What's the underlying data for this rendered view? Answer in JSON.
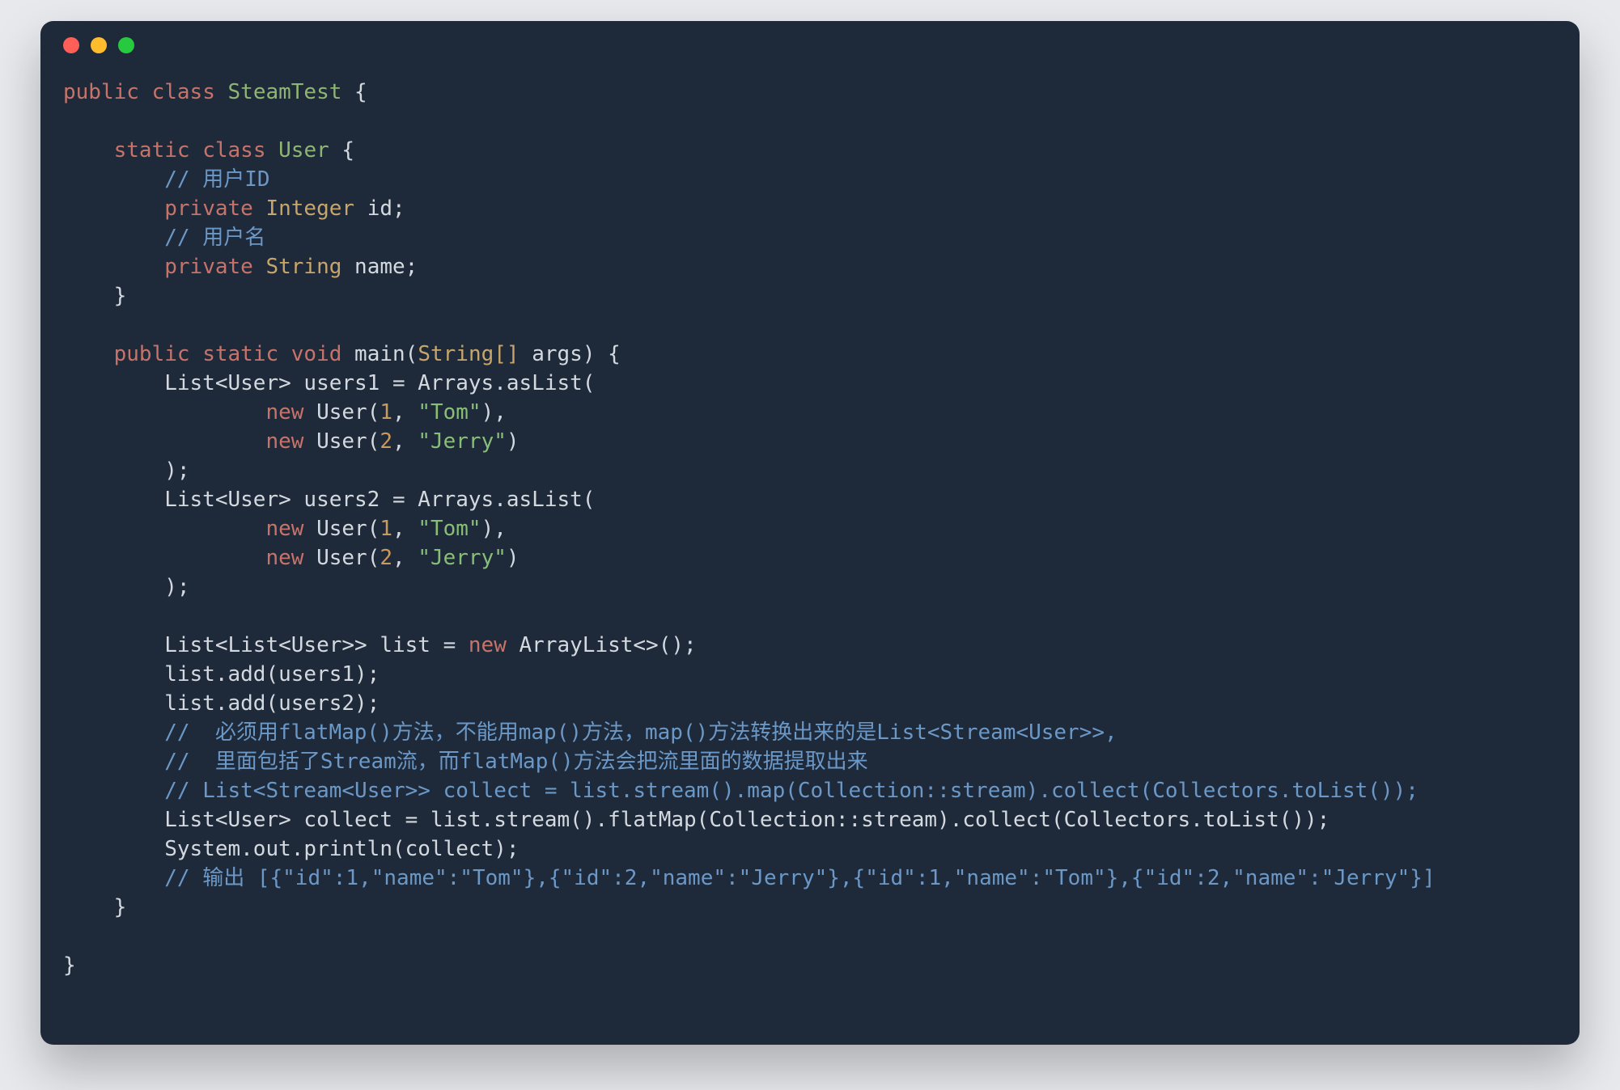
{
  "window": {
    "dots": {
      "red": "#ff5f56",
      "yellow": "#ffbd2e",
      "green": "#27c93f"
    },
    "bg": "#1e2a3a"
  },
  "code": {
    "l01a": "public",
    "l01b": " ",
    "l01c": "class",
    "l01d": " ",
    "l01e": "SteamTest",
    "l01f": " {",
    "l02": "",
    "l03a": "    ",
    "l03b": "static",
    "l03c": " ",
    "l03d": "class",
    "l03e": " ",
    "l03f": "User",
    "l03g": " {",
    "l04a": "        ",
    "l04b": "// 用户ID",
    "l05a": "        ",
    "l05b": "private",
    "l05c": " ",
    "l05d": "Integer",
    "l05e": " id;",
    "l06a": "        ",
    "l06b": "// 用户名",
    "l07a": "        ",
    "l07b": "private",
    "l07c": " ",
    "l07d": "String",
    "l07e": " name;",
    "l08a": "    }",
    "l09": "",
    "l10a": "    ",
    "l10b": "public",
    "l10c": " ",
    "l10d": "static",
    "l10e": " ",
    "l10f": "void",
    "l10g": " main(",
    "l10h": "String[]",
    "l10i": " args) {",
    "l11a": "        List<User> users1 = Arrays.asList(",
    "l12a": "                ",
    "l12b": "new",
    "l12c": " User(",
    "l12d": "1",
    "l12e": ", ",
    "l12f": "\"Tom\"",
    "l12g": "),",
    "l13a": "                ",
    "l13b": "new",
    "l13c": " User(",
    "l13d": "2",
    "l13e": ", ",
    "l13f": "\"Jerry\"",
    "l13g": ")",
    "l14a": "        );",
    "l15a": "        List<User> users2 = Arrays.asList(",
    "l16a": "                ",
    "l16b": "new",
    "l16c": " User(",
    "l16d": "1",
    "l16e": ", ",
    "l16f": "\"Tom\"",
    "l16g": "),",
    "l17a": "                ",
    "l17b": "new",
    "l17c": " User(",
    "l17d": "2",
    "l17e": ", ",
    "l17f": "\"Jerry\"",
    "l17g": ")",
    "l18a": "        );",
    "l19": "",
    "l20a": "        List<List<User>> list = ",
    "l20b": "new",
    "l20c": " ArrayList<>();",
    "l21a": "        list.add(users1);",
    "l22a": "        list.add(users2);",
    "l23a": "        ",
    "l23b": "//  必须用flatMap()方法，不能用map()方法，map()方法转换出来的是List<Stream<User>>,",
    "l24a": "        ",
    "l24b": "//  里面包括了Stream流，而flatMap()方法会把流里面的数据提取出来",
    "l25a": "        ",
    "l25b": "// List<Stream<User>> collect = list.stream().map(Collection::stream).collect(Collectors.toList());",
    "l26a": "        List<User> collect = list.stream().flatMap(Collection::stream).collect(Collectors.toList());",
    "l27a": "        System.out.println(collect);",
    "l28a": "        ",
    "l28b": "// 输出 [{\"id\":1,\"name\":\"Tom\"},{\"id\":2,\"name\":\"Jerry\"},{\"id\":1,\"name\":\"Tom\"},{\"id\":2,\"name\":\"Jerry\"}]",
    "l29a": "    }",
    "l30": "",
    "l31a": "}"
  }
}
